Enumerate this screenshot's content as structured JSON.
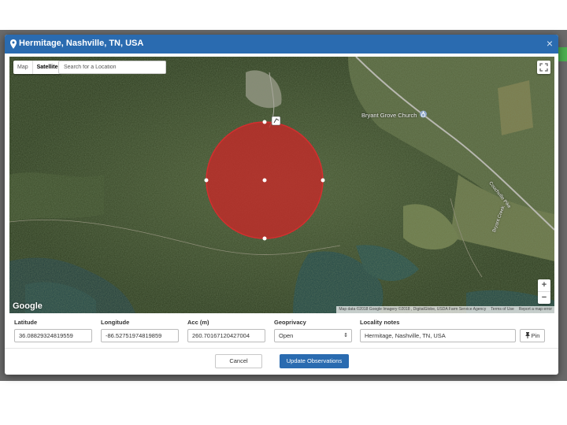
{
  "modal": {
    "title": "Hermitage, Nashville, TN, USA",
    "close_symbol": "×"
  },
  "map": {
    "type_buttons": [
      "Map",
      "Satellite"
    ],
    "active_type": "Satellite",
    "search_placeholder": "Search for a Location",
    "zoom_in": "+",
    "zoom_out": "−",
    "logo": "Google",
    "attribution": [
      "Map data ©2018 Google Imagery ©2018 , DigitalGlobe, USDA Farm Service Agency",
      "Terms of Use",
      "Report a map error"
    ],
    "labels": {
      "church": "Bryant Grove Church",
      "road": "Couchville Pike",
      "creek": "Bryant Creek"
    },
    "icons": {
      "fullscreen": "fullscreen-icon",
      "church": "church-icon",
      "marker": "map-pin-marker-icon"
    },
    "accuracy_circle_color": "#c62828"
  },
  "form": {
    "latitude": {
      "label": "Latitude",
      "value": "36.08829324819559"
    },
    "longitude": {
      "label": "Longitude",
      "value": "-86.52751974819859"
    },
    "accuracy": {
      "label": "Acc (m)",
      "value": "260.70167120427004"
    },
    "geoprivacy": {
      "label": "Geoprivacy",
      "value": "Open"
    },
    "locality": {
      "label": "Locality notes",
      "value": "Hermitage, Nashville, TN, USA"
    },
    "pin_button": "Pin"
  },
  "footer": {
    "cancel": "Cancel",
    "update": "Update Observations"
  },
  "colors": {
    "header": "#2a6bb0",
    "primary_button": "#2a6bb0"
  }
}
